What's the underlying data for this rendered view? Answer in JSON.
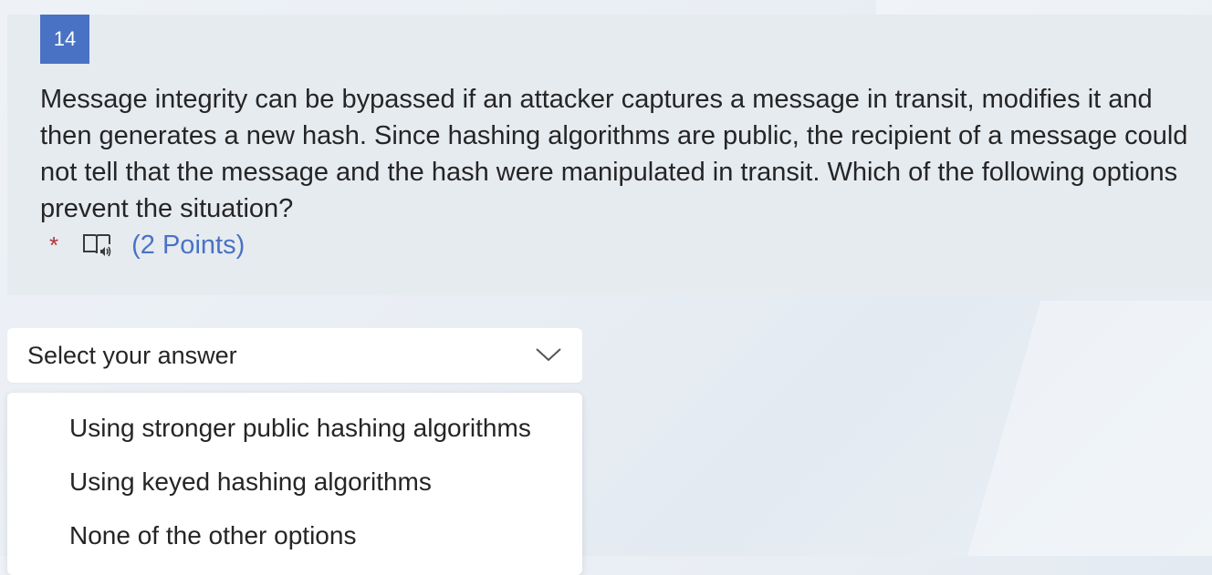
{
  "question": {
    "number": "14",
    "text": "Message integrity can be bypassed if an attacker captures a message in transit, modifies it and then generates a new hash. Since hashing algorithms are public, the recipient of a message could not tell that the message and the hash were manipulated in transit. Which of the following options prevent the situation?",
    "required_marker": "*",
    "reader_icon": "immersive-reader-icon",
    "points": "(2 Points)"
  },
  "answer_select": {
    "placeholder": "Select your answer",
    "chevron_icon": "chevron-down-icon"
  },
  "options": [
    {
      "label": "Using stronger public hashing algorithms"
    },
    {
      "label": "Using keyed hashing algorithms"
    },
    {
      "label": "None of the other options"
    }
  ],
  "colors": {
    "number_badge": "#4a72c4",
    "points_text": "#4a72c4",
    "required_star": "#b33232",
    "card_background": "#e6ebf0"
  }
}
